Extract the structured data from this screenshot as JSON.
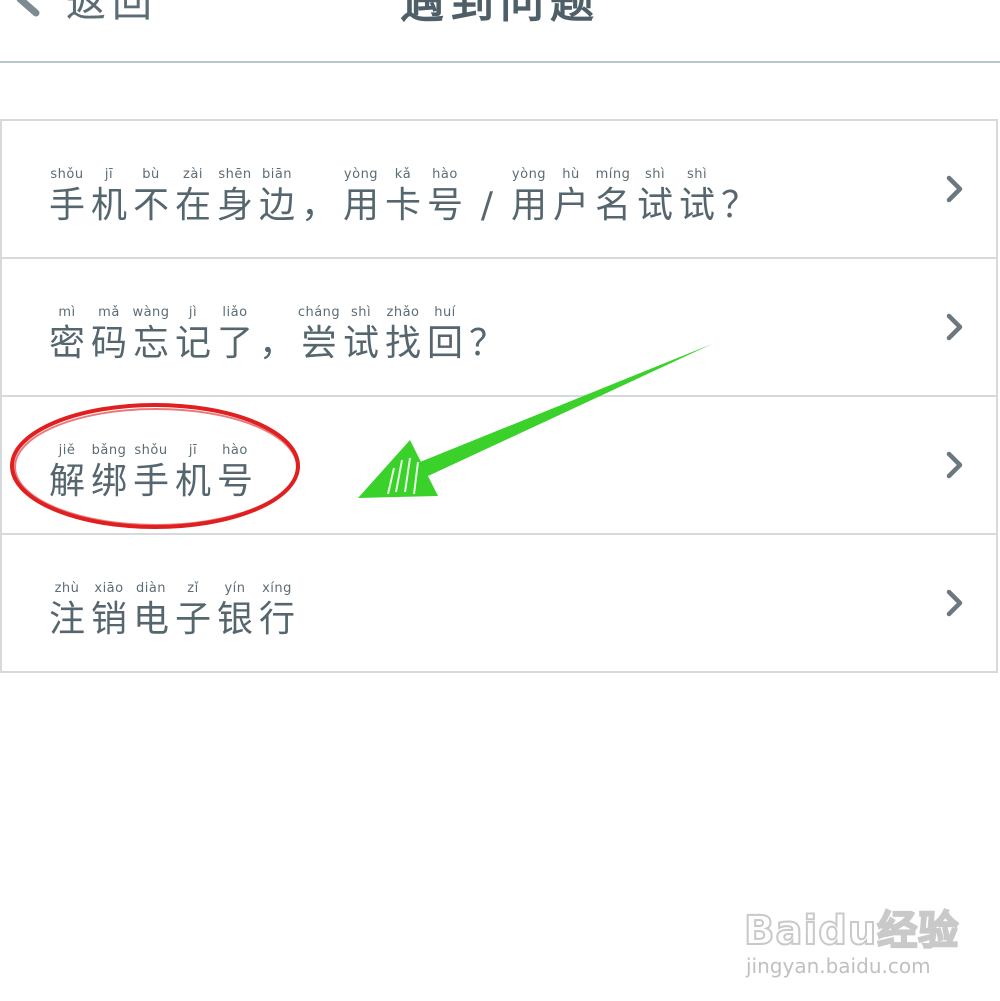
{
  "header": {
    "back_label": "返回",
    "title": "遇到问题",
    "back_icon": "chevron-left-icon"
  },
  "menu": {
    "items": [
      {
        "id": "phone-not-nearby",
        "chars": [
          {
            "py": "shǒu",
            "hz": "手"
          },
          {
            "py": "jī",
            "hz": "机"
          },
          {
            "py": "bù",
            "hz": "不"
          },
          {
            "py": "zài",
            "hz": "在"
          },
          {
            "py": "shēn",
            "hz": "身"
          },
          {
            "py": "biān",
            "hz": "边"
          },
          {
            "py": "",
            "hz": "，"
          },
          {
            "py": "yòng",
            "hz": "用"
          },
          {
            "py": "kǎ",
            "hz": "卡"
          },
          {
            "py": "hào",
            "hz": "号"
          },
          {
            "py": "",
            "hz": "/"
          },
          {
            "py": "yòng",
            "hz": "用"
          },
          {
            "py": "hù",
            "hz": "户"
          },
          {
            "py": "míng",
            "hz": "名"
          },
          {
            "py": "shì",
            "hz": "试"
          },
          {
            "py": "shì",
            "hz": "试"
          },
          {
            "py": "",
            "hz": "？"
          }
        ],
        "chevron_icon": "chevron-right-icon"
      },
      {
        "id": "forgot-password",
        "chars": [
          {
            "py": "mì",
            "hz": "密"
          },
          {
            "py": "mǎ",
            "hz": "码"
          },
          {
            "py": "wàng",
            "hz": "忘"
          },
          {
            "py": "jì",
            "hz": "记"
          },
          {
            "py": "liǎo",
            "hz": "了"
          },
          {
            "py": "",
            "hz": "，"
          },
          {
            "py": "cháng",
            "hz": "尝"
          },
          {
            "py": "shì",
            "hz": "试"
          },
          {
            "py": "zhǎo",
            "hz": "找"
          },
          {
            "py": "huí",
            "hz": "回"
          },
          {
            "py": "",
            "hz": "？"
          }
        ],
        "chevron_icon": "chevron-right-icon"
      },
      {
        "id": "unbind-phone",
        "chars": [
          {
            "py": "jiě",
            "hz": "解"
          },
          {
            "py": "bǎng",
            "hz": "绑"
          },
          {
            "py": "shǒu",
            "hz": "手"
          },
          {
            "py": "jī",
            "hz": "机"
          },
          {
            "py": "hào",
            "hz": "号"
          }
        ],
        "chevron_icon": "chevron-right-icon"
      },
      {
        "id": "cancel-ebank",
        "chars": [
          {
            "py": "zhù",
            "hz": "注"
          },
          {
            "py": "xiāo",
            "hz": "销"
          },
          {
            "py": "diàn",
            "hz": "电"
          },
          {
            "py": "zǐ",
            "hz": "子"
          },
          {
            "py": "yín",
            "hz": "银"
          },
          {
            "py": "xíng",
            "hz": "行"
          }
        ],
        "chevron_icon": "chevron-right-icon"
      }
    ]
  },
  "annotation": {
    "highlight_color": "#e02020",
    "arrow_color": "#39d12a"
  },
  "watermark": {
    "brand": "Baidu经验",
    "domain": "jingyan.baidu.com"
  }
}
